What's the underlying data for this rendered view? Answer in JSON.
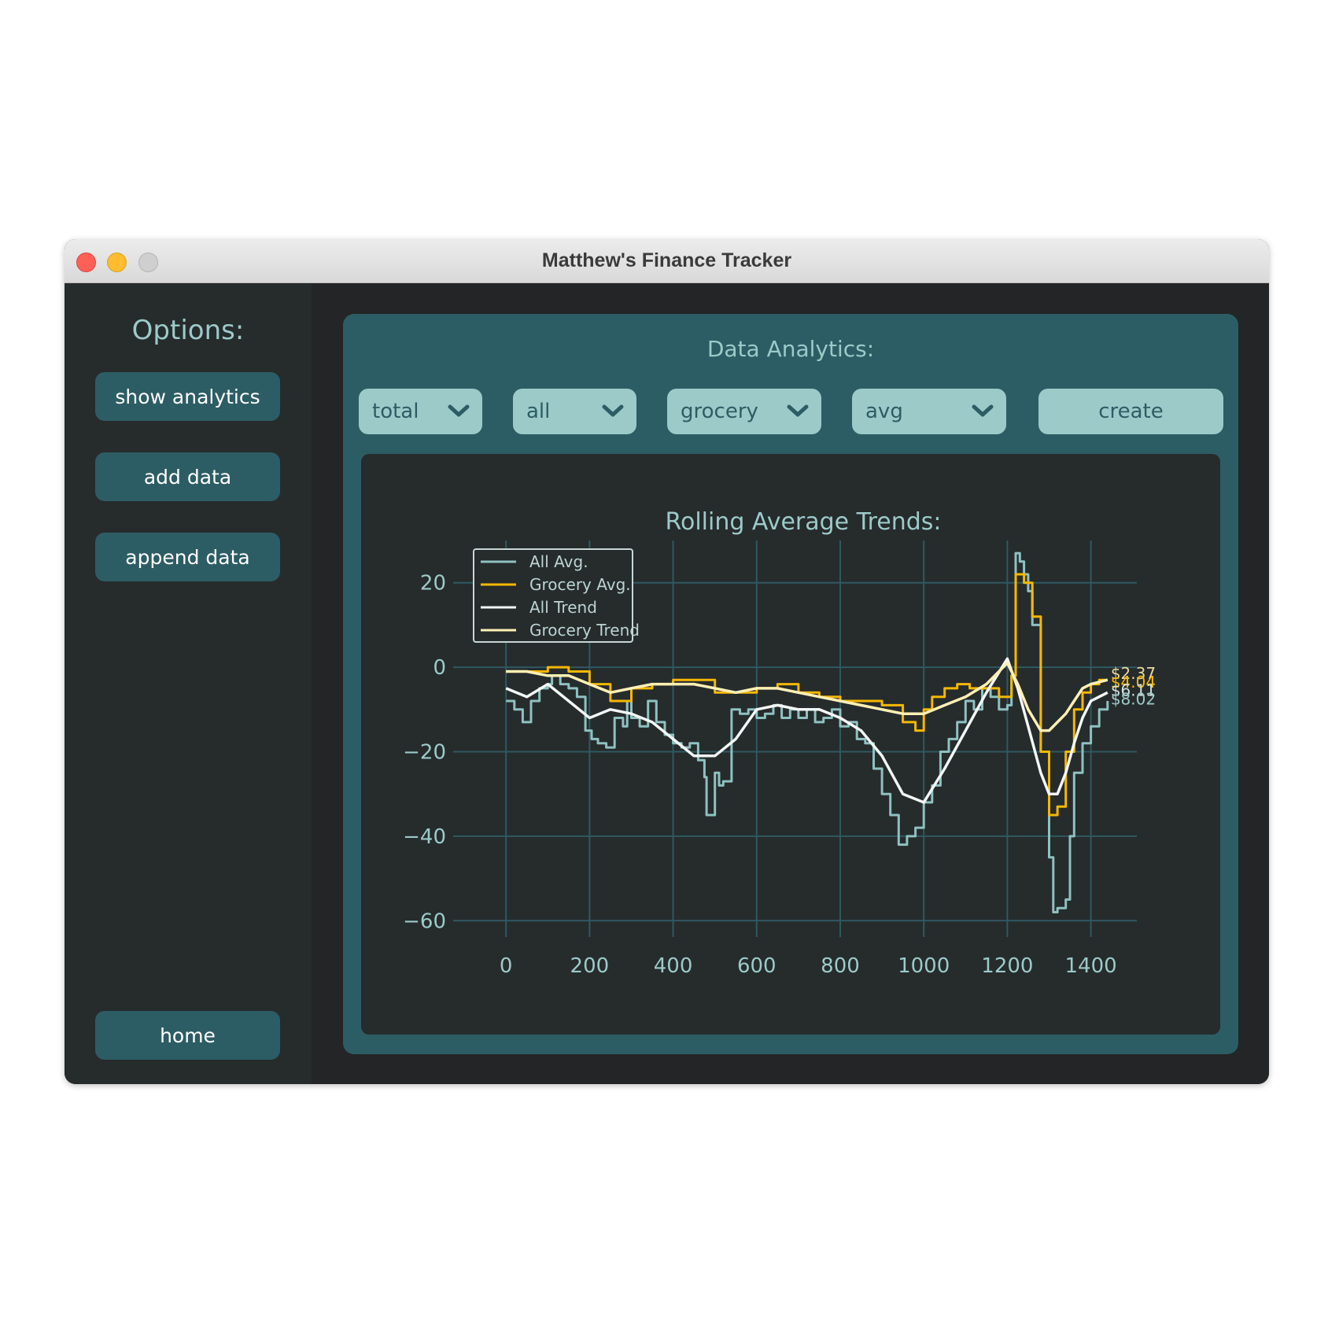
{
  "window": {
    "title": "Matthew's Finance Tracker"
  },
  "sidebar": {
    "heading": "Options:",
    "buttons": {
      "show_analytics": "show analytics",
      "add_data": "add data",
      "append_data": "append data",
      "home": "home"
    }
  },
  "panel": {
    "title": "Data Analytics:",
    "dropdowns": {
      "d1": "total",
      "d2": "all",
      "d3": "grocery",
      "d4": "avg"
    },
    "create_label": "create"
  },
  "colors": {
    "accent": "#2d5d64",
    "light": "#9ccac9",
    "gold": "#f5b800",
    "trend_white": "#f2f6f5",
    "trend_cream": "#fff0b3"
  },
  "chart_data": {
    "type": "line",
    "title": "Rolling Average Trends:",
    "xlabel": "",
    "ylabel": "",
    "xlim": [
      -70,
      1510
    ],
    "ylim": [
      -62,
      30
    ],
    "xticks": [
      0,
      200,
      400,
      600,
      800,
      1000,
      1200,
      1400
    ],
    "yticks": [
      20,
      0,
      -20,
      -40,
      -60
    ],
    "grid": true,
    "legend_position": "top-left",
    "series": [
      {
        "name": "All Avg.",
        "color": "#8fc1c1",
        "step": true,
        "x": [
          0,
          20,
          40,
          60,
          80,
          100,
          110,
          130,
          150,
          170,
          190,
          205,
          220,
          240,
          260,
          280,
          290,
          300,
          320,
          340,
          360,
          380,
          400,
          420,
          440,
          460,
          475,
          480,
          490,
          500,
          510,
          520,
          540,
          560,
          580,
          600,
          620,
          640,
          660,
          680,
          700,
          720,
          740,
          760,
          780,
          800,
          820,
          840,
          860,
          880,
          900,
          920,
          940,
          960,
          980,
          1000,
          1020,
          1040,
          1060,
          1080,
          1100,
          1120,
          1140,
          1160,
          1180,
          1200,
          1210,
          1220,
          1230,
          1240,
          1250,
          1260,
          1280,
          1300,
          1310,
          1320,
          1340,
          1350,
          1360,
          1380,
          1400,
          1420,
          1440
        ],
        "y": [
          -8,
          -10,
          -13,
          -8,
          -5,
          -4,
          -2,
          -4,
          -5,
          -7,
          -15,
          -17,
          -18,
          -19,
          -12,
          -14,
          -8,
          -12,
          -14,
          -8,
          -13,
          -16,
          -18,
          -19,
          -18,
          -22,
          -26,
          -35,
          -35,
          -25,
          -28,
          -27,
          -10,
          -11,
          -10,
          -12,
          -11,
          -9,
          -12,
          -10,
          -12,
          -10,
          -13,
          -12,
          -10,
          -14,
          -13,
          -17,
          -18,
          -24,
          -30,
          -35,
          -42,
          -40,
          -38,
          -32,
          -28,
          -20,
          -17,
          -13,
          -8,
          -10,
          -5,
          -7,
          -10,
          -9,
          -2,
          27,
          25,
          22,
          18,
          10,
          -20,
          -45,
          -58,
          -57,
          -55,
          -40,
          -25,
          -18,
          -14,
          -10,
          -8
        ]
      },
      {
        "name": "Grocery Avg.",
        "color": "#f5b800",
        "step": true,
        "x": [
          0,
          50,
          100,
          150,
          200,
          250,
          300,
          350,
          400,
          450,
          500,
          550,
          600,
          650,
          700,
          750,
          800,
          850,
          900,
          950,
          980,
          1000,
          1020,
          1050,
          1080,
          1110,
          1150,
          1180,
          1200,
          1210,
          1220,
          1240,
          1260,
          1280,
          1300,
          1320,
          1340,
          1360,
          1380,
          1400,
          1420,
          1440
        ],
        "y": [
          -1,
          -1,
          0,
          -1,
          -4,
          -8,
          -5,
          -4,
          -3,
          -3,
          -6,
          -6,
          -5,
          -4,
          -6,
          -7,
          -8,
          -8,
          -9,
          -13,
          -15,
          -10,
          -7,
          -5,
          -4,
          -5,
          -5,
          -7,
          -7,
          -2,
          22,
          20,
          12,
          -20,
          -35,
          -33,
          -20,
          -10,
          -6,
          -4,
          -3,
          -3
        ]
      },
      {
        "name": "All Trend",
        "color": "#f2f6f5",
        "step": false,
        "x": [
          0,
          50,
          100,
          150,
          200,
          250,
          300,
          350,
          400,
          450,
          500,
          550,
          600,
          650,
          700,
          750,
          800,
          850,
          900,
          950,
          1000,
          1050,
          1100,
          1150,
          1200,
          1225,
          1250,
          1280,
          1300,
          1320,
          1340,
          1360,
          1380,
          1400,
          1440
        ],
        "y": [
          -5,
          -7,
          -4,
          -8,
          -12,
          -10,
          -11,
          -13,
          -17,
          -21,
          -21,
          -17,
          -10,
          -9,
          -10,
          -10,
          -12,
          -15,
          -21,
          -30,
          -32,
          -24,
          -15,
          -6,
          2,
          -5,
          -14,
          -25,
          -30,
          -30,
          -25,
          -18,
          -12,
          -8,
          -6
        ]
      },
      {
        "name": "Grocery Trend",
        "color": "#fff0b3",
        "step": false,
        "x": [
          0,
          50,
          100,
          150,
          200,
          250,
          300,
          350,
          400,
          450,
          500,
          550,
          600,
          650,
          700,
          750,
          800,
          850,
          900,
          950,
          1000,
          1050,
          1100,
          1150,
          1200,
          1225,
          1250,
          1280,
          1300,
          1320,
          1340,
          1360,
          1380,
          1400,
          1440
        ],
        "y": [
          -1,
          -1,
          -2,
          -2,
          -4,
          -6,
          -5,
          -4,
          -4,
          -4,
          -5,
          -6,
          -5,
          -5,
          -6,
          -7,
          -8,
          -9,
          -10,
          -11,
          -11,
          -9,
          -7,
          -4,
          1,
          -4,
          -10,
          -15,
          -15,
          -13,
          -11,
          -8,
          -5,
          -4,
          -3
        ]
      }
    ],
    "end_labels": [
      {
        "text": "$2.37",
        "y": -1.5,
        "color": "#e8d9a0"
      },
      {
        "text": "$4.04",
        "y": -3.5,
        "color": "#f5b800"
      },
      {
        "text": "$6.11",
        "y": -5.5,
        "color": "#cfe1e0"
      },
      {
        "text": "$8.02",
        "y": -7.5,
        "color": "#9ccac9"
      }
    ]
  }
}
